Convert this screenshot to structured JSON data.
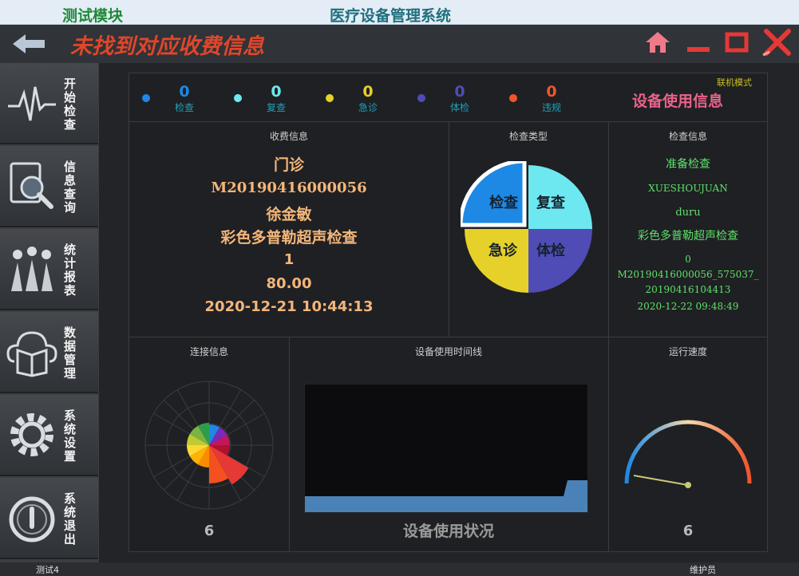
{
  "titlebar": {
    "module": "测试模块",
    "title": "医疗设备管理系统"
  },
  "toolbar": {
    "message": "未找到对应收费信息"
  },
  "sidebar": {
    "items": [
      {
        "label": "开始检查"
      },
      {
        "label": "信息查询"
      },
      {
        "label": "统计报表"
      },
      {
        "label": "数据管理"
      },
      {
        "label": "系统设置"
      },
      {
        "label": "系统退出"
      }
    ]
  },
  "stats": [
    {
      "value": "0",
      "label": "检查",
      "color": "#1e88e5"
    },
    {
      "value": "0",
      "label": "复查",
      "color": "#6ee8f0"
    },
    {
      "value": "0",
      "label": "急诊",
      "color": "#e6d12a"
    },
    {
      "value": "0",
      "label": "体检",
      "color": "#4f4cb6"
    },
    {
      "value": "0",
      "label": "违规",
      "color": "#f0552a"
    }
  ],
  "mode": "联机模式",
  "device_title": "设备使用信息",
  "fee": {
    "title": "收费信息",
    "lines": [
      "门诊",
      "M20190416000056",
      "徐金敏",
      "彩色多普勒超声检查",
      "1",
      "80.00",
      "2020-12-21 10:44:13"
    ]
  },
  "check_type": {
    "title": "检查类型",
    "segments": [
      {
        "label": "检查",
        "color": "#1e88e5"
      },
      {
        "label": "复查",
        "color": "#6ee8f0"
      },
      {
        "label": "急诊",
        "color": "#e6d12a"
      },
      {
        "label": "体检",
        "color": "#4f4cb6"
      }
    ]
  },
  "check_info": {
    "title": "检查信息",
    "lines": [
      "准备检查",
      "XUESHOUJUAN",
      "duru",
      "彩色多普勒超声检查",
      "0",
      "M20190416000056_575037_",
      "20190416104413",
      "2020-12-22 09:48:49"
    ]
  },
  "connection": {
    "title": "连接信息",
    "value": "6"
  },
  "timeline": {
    "title": "设备使用时间线",
    "caption": "设备使用状况"
  },
  "speed": {
    "title": "运行速度",
    "value": "6"
  },
  "statusbar": {
    "left": "测试4",
    "right": "维护员"
  }
}
